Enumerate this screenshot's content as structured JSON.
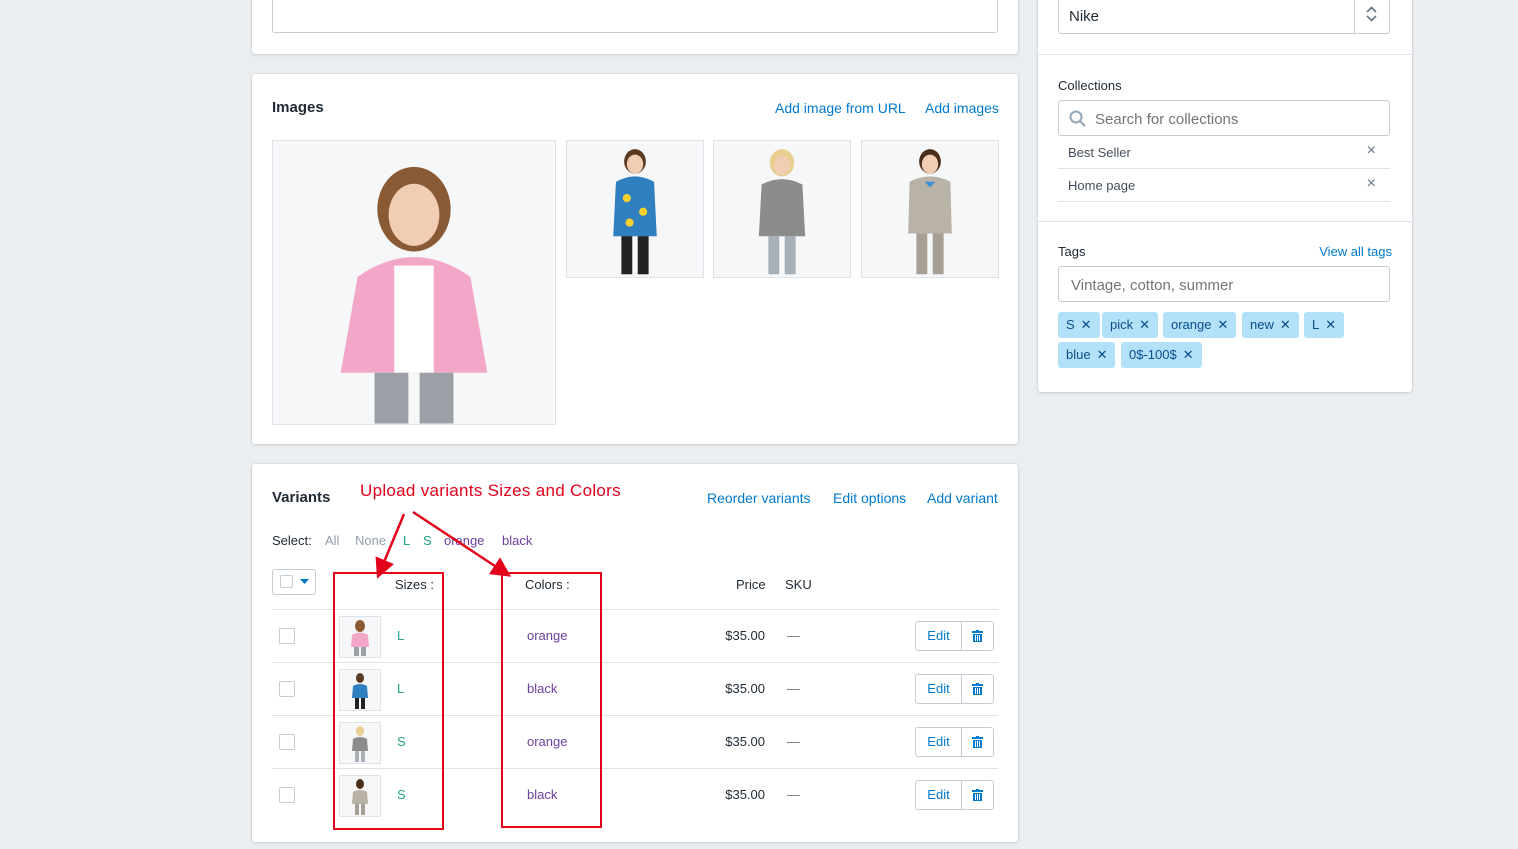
{
  "sidebar": {
    "vendor_value": "Nike",
    "collections_label": "Collections",
    "collections_search_placeholder": "Search for collections",
    "collections": [
      "Best Seller",
      "Home page"
    ],
    "remove_symbol": "×",
    "tags_label": "Tags",
    "view_all_tags": "View all tags",
    "tags_placeholder": "Vintage, cotton, summer",
    "tags": [
      "S",
      "pick",
      "orange",
      "new",
      "L",
      "blue",
      "0$-100$"
    ],
    "tag_remove_symbol": "✕"
  },
  "images": {
    "title": "Images",
    "add_from_url": "Add image from URL",
    "add_images": "Add images"
  },
  "variants": {
    "title": "Variants",
    "reorder": "Reorder variants",
    "edit_options": "Edit options",
    "add_variant": "Add variant",
    "select_label": "Select:",
    "select_options": [
      "All",
      "None",
      "L",
      "S",
      "orange",
      "black"
    ],
    "headers": {
      "sizes": "Sizes :",
      "colors": "Colors :",
      "price": "Price",
      "sku": "SKU"
    },
    "rows": [
      {
        "size": "L",
        "color": "orange",
        "price": "$35.00",
        "sku": "—",
        "edit": "Edit"
      },
      {
        "size": "L",
        "color": "black",
        "price": "$35.00",
        "sku": "—",
        "edit": "Edit"
      },
      {
        "size": "S",
        "color": "orange",
        "price": "$35.00",
        "sku": "—",
        "edit": "Edit"
      },
      {
        "size": "S",
        "color": "black",
        "price": "$35.00",
        "sku": "—",
        "edit": "Edit"
      }
    ]
  },
  "annotation": {
    "text": "Upload variants Sizes and Colors"
  },
  "colors": {
    "link": "#007ace",
    "tag_bg": "#b4e1fa",
    "annotation": "#e3001b",
    "size_text": "#21a48b",
    "color_text": "#6b3fa0"
  }
}
